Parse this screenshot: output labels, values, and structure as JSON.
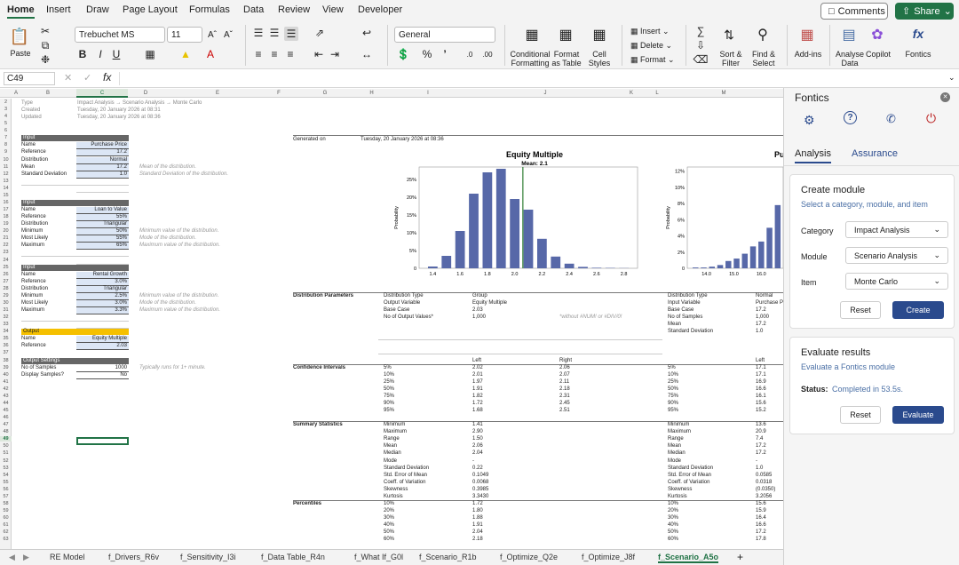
{
  "ribbon_tabs": [
    "Home",
    "Insert",
    "Draw",
    "Page Layout",
    "Formulas",
    "Data",
    "Review",
    "View",
    "Developer"
  ],
  "comments_label": "Comments",
  "share_label": "Share",
  "ribbon": {
    "paste": "Paste",
    "font_name": "Trebuchet MS",
    "font_size": "11",
    "number_format": "General",
    "conditional": [
      "Conditional",
      "Formatting"
    ],
    "format_table": [
      "Format",
      "as Table"
    ],
    "cell_styles": [
      "Cell",
      "Styles"
    ],
    "insert": "Insert",
    "delete": "Delete",
    "format": "Format",
    "sort": [
      "Sort &",
      "Filter"
    ],
    "find": [
      "Find &",
      "Select"
    ],
    "addins": "Add-ins",
    "analyse": [
      "Analyse",
      "Data"
    ],
    "copilot": "Copilot",
    "fontics": "Fontics"
  },
  "formula_bar": {
    "cell_ref": "C49",
    "formula": ""
  },
  "columns": [
    "A",
    "B",
    "C",
    "D",
    "E",
    "F",
    "G",
    "H",
    "I",
    "J",
    "K",
    "L",
    "M"
  ],
  "rows": [
    "2",
    "3",
    "4",
    "5",
    "6",
    "7",
    "8",
    "9",
    "10",
    "11",
    "12",
    "13",
    "14",
    "15",
    "16",
    "17",
    "18",
    "19",
    "20",
    "21",
    "22",
    "23",
    "24",
    "25",
    "26",
    "27",
    "28",
    "29",
    "30",
    "31",
    "32",
    "33",
    "34",
    "35",
    "36",
    "37",
    "38",
    "39",
    "40",
    "41",
    "42",
    "43",
    "44",
    "45",
    "46",
    "47",
    "48",
    "49",
    "50",
    "51",
    "52",
    "53",
    "54",
    "55",
    "56",
    "57",
    "58",
    "59",
    "60",
    "61",
    "62",
    "63"
  ],
  "header": {
    "type_label": "Type",
    "type_value": "Impact Analysis → Scenario Analysis → Monte Carlo",
    "created_label": "Created",
    "created_value": "Tuesday, 20 January 2026 at 08:31",
    "updated_label": "Updated",
    "updated_value": "Tuesday, 20 January 2026 at 08:36"
  },
  "input1": {
    "title": "Input",
    "rows": [
      [
        "Name",
        "Purchase Price"
      ],
      [
        "Reference",
        "17.2"
      ],
      [
        "Distribution",
        "Normal"
      ],
      [
        "Mean",
        "17.2"
      ],
      [
        "Standard Deviation",
        "1.0"
      ]
    ],
    "notes": [
      "Mean of the distribution.",
      "Standard Deviation of the distribution."
    ]
  },
  "input2": {
    "title": "Input",
    "rows": [
      [
        "Name",
        "Loan to Value"
      ],
      [
        "Reference",
        "55%"
      ],
      [
        "Distribution",
        "Triangular"
      ],
      [
        "Minimum",
        "50%"
      ],
      [
        "Most Likely",
        "55%"
      ],
      [
        "Maximum",
        "65%"
      ]
    ],
    "notes": [
      "Minimum value of the distribution.",
      "Mode of the distribution.",
      "Maximum value of the distribution."
    ]
  },
  "input3": {
    "title": "Input",
    "rows": [
      [
        "Name",
        "Rental Growth"
      ],
      [
        "Reference",
        "3.0%"
      ],
      [
        "Distribution",
        "Triangular"
      ],
      [
        "Minimum",
        "2.5%"
      ],
      [
        "Most Likely",
        "3.0%"
      ],
      [
        "Maximum",
        "3.3%"
      ]
    ],
    "notes": [
      "Minimum value of the distribution.",
      "Mode of the distribution.",
      "Maximum value of the distribution."
    ]
  },
  "output": {
    "title": "Output",
    "rows": [
      [
        "Name",
        "Equity Multiple"
      ],
      [
        "Reference",
        "2.03"
      ]
    ]
  },
  "settings": {
    "title": "Output Settings",
    "rows": [
      [
        "No of Samples",
        "1000"
      ],
      [
        "Display Samples?",
        "No"
      ]
    ],
    "note": "Typically runs for 1+ minute."
  },
  "generated_label": "Generated on",
  "generated_value": "Tuesday, 20 January 2026 at 08:36",
  "sections": {
    "dist": "Distribution Parameters",
    "ci": "Confidence Intervals",
    "summary": "Summary Statistics",
    "pct": "Percentiles"
  },
  "dist_params": [
    [
      "Distribution Type",
      "Group"
    ],
    [
      "Output Variable",
      "Equity Multiple"
    ],
    [
      "Base Case",
      "2.03"
    ],
    [
      "No of Output Values*",
      "1,000"
    ]
  ],
  "dist_note": "*without #NUM! or #DIV/0!",
  "dist_params2": [
    [
      "Distribution Type",
      "Normal"
    ],
    [
      "Input Variable",
      "Purchase P"
    ],
    [
      "Base Case",
      "17.2"
    ],
    [
      "No of Samples",
      "1,000"
    ],
    [
      "Mean",
      "17.2"
    ],
    [
      "Standard Deviation",
      "1.0"
    ]
  ],
  "ci_header": [
    "Left",
    "Right"
  ],
  "ci": [
    [
      "5%",
      "2.02",
      "2.06"
    ],
    [
      "10%",
      "2.01",
      "2.07"
    ],
    [
      "25%",
      "1.97",
      "2.11"
    ],
    [
      "50%",
      "1.91",
      "2.18"
    ],
    [
      "75%",
      "1.82",
      "2.31"
    ],
    [
      "90%",
      "1.72",
      "2.45"
    ],
    [
      "95%",
      "1.68",
      "2.51"
    ]
  ],
  "ci2_header": "Left",
  "ci2": [
    [
      "5%",
      "17.1"
    ],
    [
      "10%",
      "17.1"
    ],
    [
      "25%",
      "16.9"
    ],
    [
      "50%",
      "16.6"
    ],
    [
      "75%",
      "16.1"
    ],
    [
      "90%",
      "15.6"
    ],
    [
      "95%",
      "15.2"
    ]
  ],
  "summary": [
    [
      "Minimum",
      "1.41"
    ],
    [
      "Maximum",
      "2.90"
    ],
    [
      "Range",
      "1.50"
    ],
    [
      "Mean",
      "2.06"
    ],
    [
      "Median",
      "2.04"
    ],
    [
      "Mode",
      "-"
    ],
    [
      "Standard Deviation",
      "0.22"
    ],
    [
      "Std. Error of Mean",
      "0.1049"
    ],
    [
      "Coeff. of Variation",
      "0.0068"
    ],
    [
      "Skewness",
      "0.3985"
    ],
    [
      "Kurtosis",
      "3.3430"
    ]
  ],
  "summary2": [
    [
      "Minimum",
      "13.6"
    ],
    [
      "Maximum",
      "20.9"
    ],
    [
      "Range",
      "7.4"
    ],
    [
      "Mean",
      "17.2"
    ],
    [
      "Median",
      "17.2"
    ],
    [
      "Mode",
      "-"
    ],
    [
      "Standard Deviation",
      "1.0"
    ],
    [
      "Std. Error of Mean",
      "0.0585"
    ],
    [
      "Coeff. of Variation",
      "0.0318"
    ],
    [
      "Skewness",
      "(0.0350)"
    ],
    [
      "Kurtosis",
      "3.2056"
    ]
  ],
  "percentiles": [
    [
      "10%",
      "1.72"
    ],
    [
      "20%",
      "1.80"
    ],
    [
      "30%",
      "1.88"
    ],
    [
      "40%",
      "1.91"
    ],
    [
      "50%",
      "2.04"
    ],
    [
      "60%",
      "2.18"
    ]
  ],
  "percentiles2": [
    [
      "10%",
      "15.6"
    ],
    [
      "20%",
      "15.9"
    ],
    [
      "30%",
      "16.4"
    ],
    [
      "40%",
      "16.6"
    ],
    [
      "50%",
      "17.2"
    ],
    [
      "60%",
      "17.8"
    ]
  ],
  "chart_data": [
    {
      "type": "bar",
      "title": "Equity Multiple",
      "subtitle": "Mean: 2.1",
      "ylabel": "Probability",
      "xlabel": "",
      "x": [
        1.4,
        1.5,
        1.6,
        1.7,
        1.8,
        1.9,
        2.0,
        2.1,
        2.2,
        2.3,
        2.4,
        2.5,
        2.6,
        2.7,
        2.8
      ],
      "values": [
        0.5,
        3.5,
        10.5,
        21,
        27,
        28,
        19.5,
        16.5,
        8.3,
        3.3,
        1.3,
        0.4,
        0.15,
        0.1,
        0.05
      ],
      "xticks": [
        "1.4",
        "1.6",
        "1.8",
        "2.0",
        "2.2",
        "2.4",
        "2.6",
        "2.8"
      ],
      "yticks": [
        "0",
        "5%",
        "10%",
        "15%",
        "20%",
        "25%"
      ],
      "ylim": [
        0,
        28.5
      ],
      "xlim": [
        1.3,
        2.9
      ],
      "mean_line": 2.06,
      "grid": false
    },
    {
      "type": "bar",
      "title": "Pu",
      "ylabel": "Probability",
      "xlabel": "",
      "x": [
        13.6,
        13.9,
        14.2,
        14.5,
        14.8,
        15.1,
        15.4,
        15.7,
        16.0,
        16.3,
        16.6
      ],
      "values": [
        0.1,
        0.1,
        0.2,
        0.4,
        0.9,
        1.2,
        1.8,
        2.7,
        3.3,
        5.0,
        7.8
      ],
      "xticks": [
        "14.0",
        "15.0",
        "16.0"
      ],
      "yticks": [
        "0",
        "2%",
        "4%",
        "6%",
        "8%",
        "10%",
        "12%"
      ],
      "ylim": [
        0,
        12.5
      ],
      "xlim": [
        13.3,
        16.8
      ],
      "grid": false
    }
  ],
  "sheet_tabs": [
    "RE Model",
    "f_Drivers_R6v",
    "f_Sensitivity_I3i",
    "f_Data Table_R4n",
    "f_What If_G0l",
    "f_Scenario_R1b",
    "f_Optimize_Q2e",
    "f_Optimize_J8f",
    "f_Scenario_A5o"
  ],
  "pane": {
    "title": "Fontics",
    "tabs": [
      "Analysis",
      "Assurance"
    ],
    "create": {
      "title": "Create module",
      "subtitle": "Select a category, module, and item",
      "fields": [
        [
          "Category",
          "Impact Analysis"
        ],
        [
          "Module",
          "Scenario Analysis"
        ],
        [
          "Item",
          "Monte Carlo"
        ]
      ],
      "reset": "Reset",
      "create": "Create"
    },
    "evaluate": {
      "title": "Evaluate results",
      "subtitle": "Evaluate a Fontics module",
      "status_label": "Status:",
      "status_value": "Completed in 53.5s.",
      "reset": "Reset",
      "evaluate": "Evaluate"
    }
  },
  "colors": {
    "accent": "#217346",
    "bar": "#5768a8",
    "mean": "#2e7d32",
    "pane_button": "#2a4a8d"
  }
}
